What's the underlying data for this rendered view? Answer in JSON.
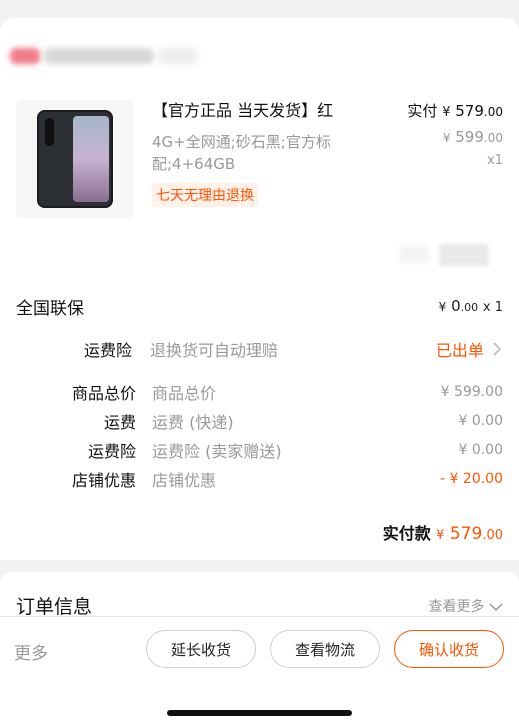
{
  "product": {
    "title": "【官方正品 当天发货】红",
    "spec": "4G+全网通;砂石黑;官方标配;4+64GB",
    "tag": "七天无理由退换",
    "actual_label": "实付",
    "currency": "¥",
    "actual_int": "579",
    "actual_cents": ".00",
    "orig_int": "599",
    "orig_cents": ".00",
    "qty": "x1"
  },
  "warranty": {
    "label": "全国联保",
    "currency": "¥",
    "int": "0",
    "cents": ".00",
    "qty": "x 1"
  },
  "freight_insurance": {
    "label": "运费险",
    "desc": "退换货可自动理赔",
    "status": "已出单"
  },
  "summary": [
    {
      "label": "商品总价",
      "desc": "商品总价",
      "value": "¥ 599.00"
    },
    {
      "label": "运费",
      "desc": "运费 (快递)",
      "value": "¥ 0.00"
    },
    {
      "label": "运费险",
      "desc": "运费险 (卖家赠送)",
      "value": "¥ 0.00"
    },
    {
      "label": "店铺优惠",
      "desc": "店铺优惠",
      "value": "- ¥ 20.00"
    }
  ],
  "total": {
    "label": "实付款",
    "currency": "¥",
    "int": "579",
    "cents": ".00"
  },
  "order_info": {
    "title": "订单信息",
    "more": "查看更多"
  },
  "footer": {
    "more": "更多",
    "extend": "延长收货",
    "logistics": "查看物流",
    "confirm": "确认收货"
  },
  "colors": {
    "accent": "#ff5500",
    "muted": "#999999",
    "text": "#222222"
  }
}
